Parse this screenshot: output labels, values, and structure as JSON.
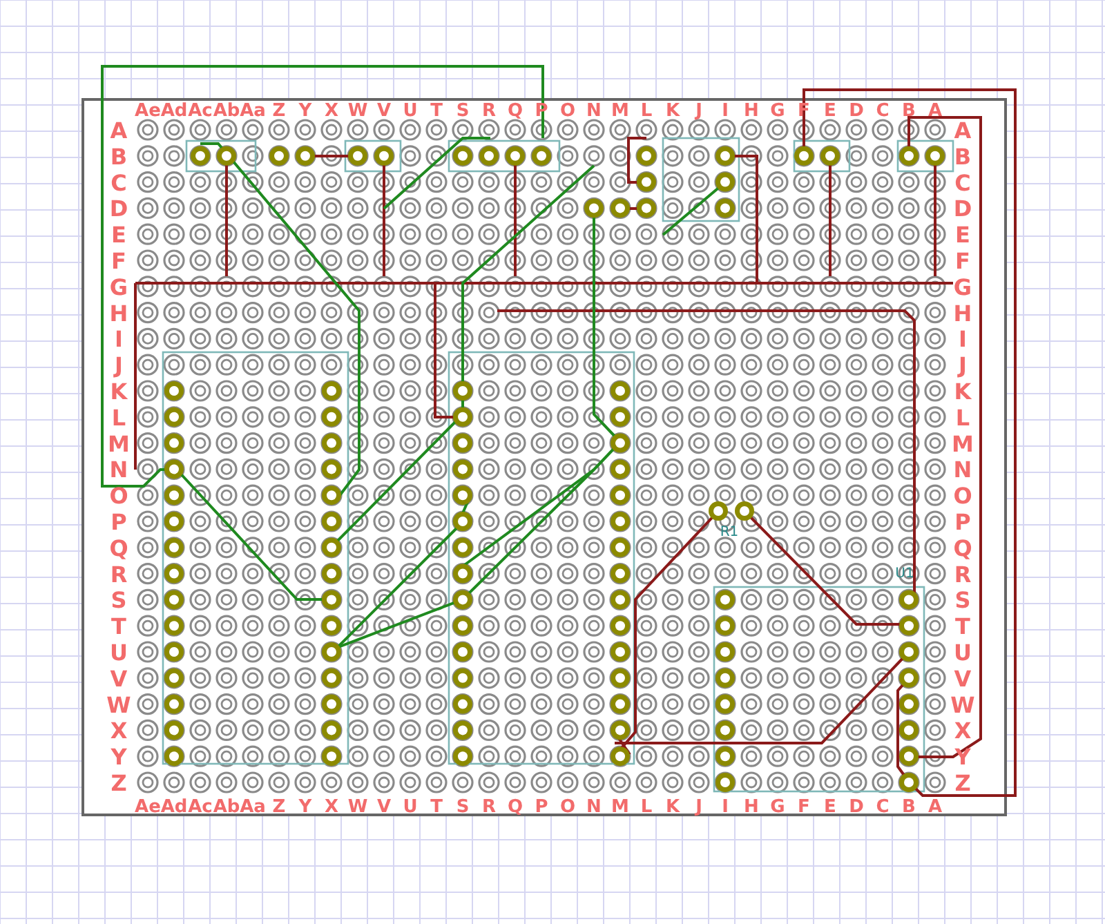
{
  "board": {
    "top_columns": [
      "Ae",
      "Ad",
      "Ac",
      "Ab",
      "Aa",
      "Z",
      "Y",
      "X",
      "W",
      "V",
      "U",
      "T",
      "S",
      "R",
      "Q",
      "P",
      "O",
      "N",
      "M",
      "L",
      "K",
      "J",
      "I",
      "H",
      "G",
      "F",
      "E",
      "D",
      "C",
      "B",
      "A"
    ],
    "bottom_columns": [
      "Ae",
      "Ad",
      "Ac",
      "Ab",
      "Aa",
      "Z",
      "Y",
      "X",
      "W",
      "V",
      "U",
      "T",
      "S",
      "R",
      "Q",
      "P",
      "O",
      "N",
      "M",
      "L",
      "K",
      "J",
      "I",
      "H",
      "G",
      "F",
      "E",
      "D",
      "C",
      "B",
      "A"
    ],
    "left_rows": [
      "A",
      "B",
      "C",
      "D",
      "E",
      "F",
      "G",
      "H",
      "I",
      "J",
      "K",
      "L",
      "M",
      "N",
      "O",
      "P",
      "Q",
      "R",
      "S",
      "T",
      "U",
      "V",
      "W",
      "X",
      "Y",
      "Z"
    ],
    "right_rows": [
      "A",
      "B",
      "C",
      "D",
      "E",
      "F",
      "G",
      "H",
      "I",
      "J",
      "K",
      "L",
      "M",
      "N",
      "O",
      "P",
      "Q",
      "R",
      "S",
      "T",
      "U",
      "V",
      "W",
      "X",
      "Y",
      "Z"
    ],
    "part_labels": [
      "U1",
      "R1"
    ]
  }
}
